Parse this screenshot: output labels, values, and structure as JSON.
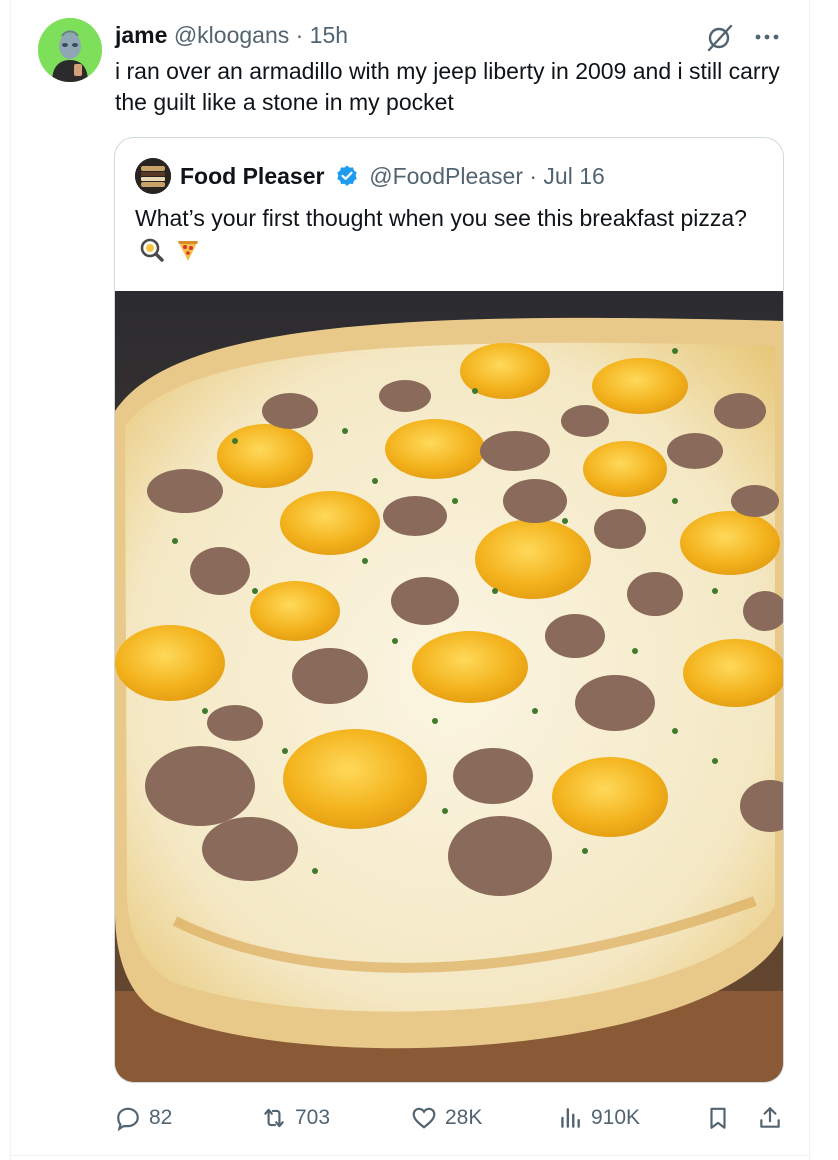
{
  "tweet": {
    "author_name": "jame",
    "author_meta": "@kloogans · 15h",
    "text": "i ran over an armadillo with my jeep liberty in 2009 and i still carry the guilt like a stone in my pocket",
    "avatar_bg": "#7ee05a"
  },
  "quote": {
    "author_name": "Food Pleaser",
    "author_meta": "@FoodPleaser · Jul 16",
    "text": "What’s your first thought when you see this breakfast pizza?",
    "emojis": [
      "magnifying-glass-icon",
      "pizza-icon"
    ],
    "verified_color": "#1d9bf0",
    "image_description_icon": "breakfast-pizza-photo"
  },
  "actions": {
    "replies": "82",
    "reposts": "703",
    "likes": "28K",
    "views": "910K"
  },
  "colors": {
    "text_primary": "#0f1419",
    "text_secondary": "#536471",
    "border": "#cfd9de"
  }
}
